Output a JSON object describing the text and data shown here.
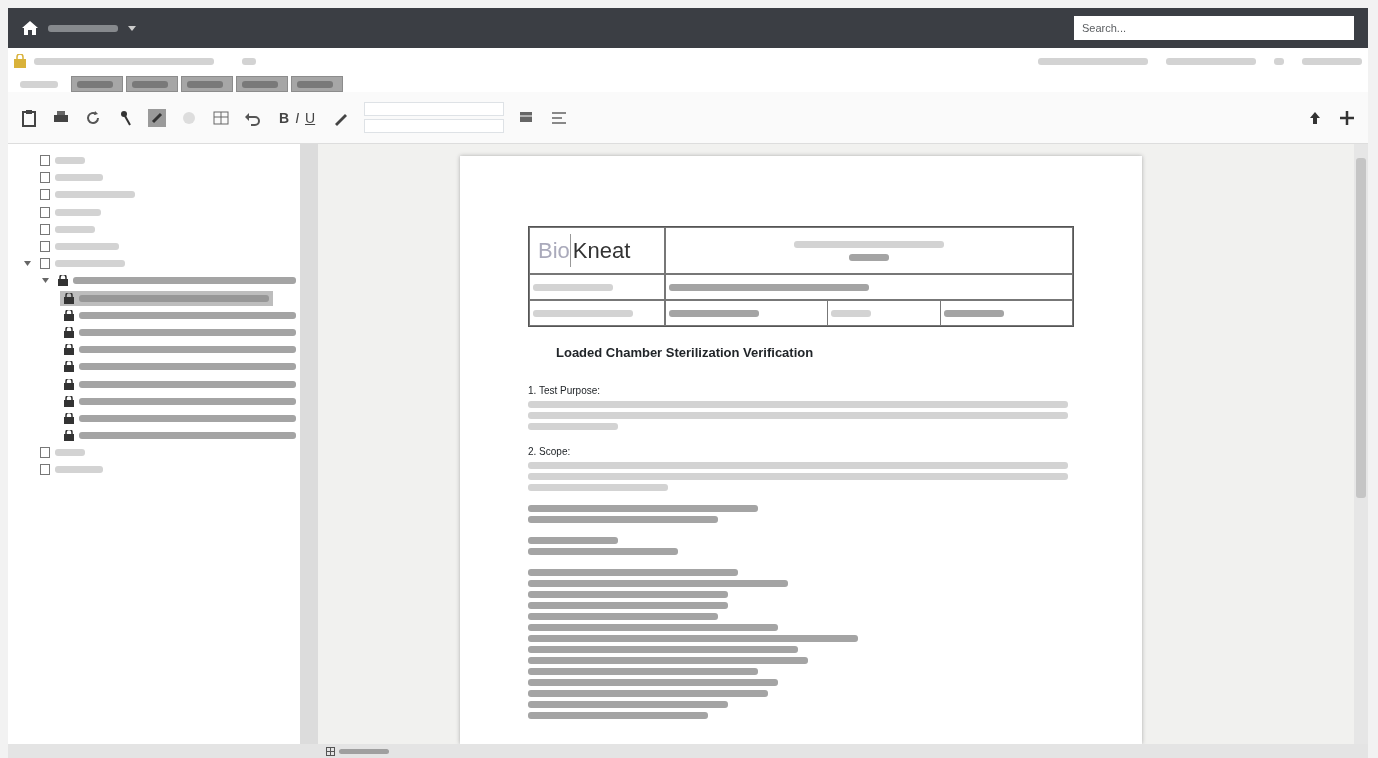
{
  "navbar": {
    "search": {
      "placeholder": "Search..."
    }
  },
  "tabs": [
    {
      "selected": true
    },
    {
      "selected": false
    },
    {
      "selected": false
    },
    {
      "selected": false
    },
    {
      "selected": false
    },
    {
      "selected": false
    }
  ],
  "toolbar": {
    "format_buttons": [
      {
        "label": "B"
      },
      {
        "label": "I"
      },
      {
        "label": "U"
      }
    ]
  },
  "tree": {
    "items": [
      {
        "selected": false
      },
      {
        "selected": false
      },
      {
        "selected": false
      },
      {
        "selected": false
      },
      {
        "selected": false
      },
      {
        "selected": false
      },
      {
        "selected": false,
        "expanded": true,
        "children": [
          {
            "selected": false,
            "expanded": true,
            "children": [
              {
                "selected": true
              },
              {
                "selected": false
              },
              {
                "selected": false
              },
              {
                "selected": false
              },
              {
                "selected": false
              },
              {
                "selected": false
              },
              {
                "selected": false
              },
              {
                "selected": false
              },
              {
                "selected": false
              }
            ]
          }
        ]
      },
      {
        "selected": false
      },
      {
        "selected": false
      }
    ]
  },
  "document": {
    "logo": {
      "part_1": "Bio",
      "part_2": "Kneat"
    },
    "heading": "Loaded Chamber Sterilization Verification",
    "sections": [
      {
        "title": "1. Test Purpose:"
      },
      {
        "title": "2. Scope:"
      }
    ]
  }
}
